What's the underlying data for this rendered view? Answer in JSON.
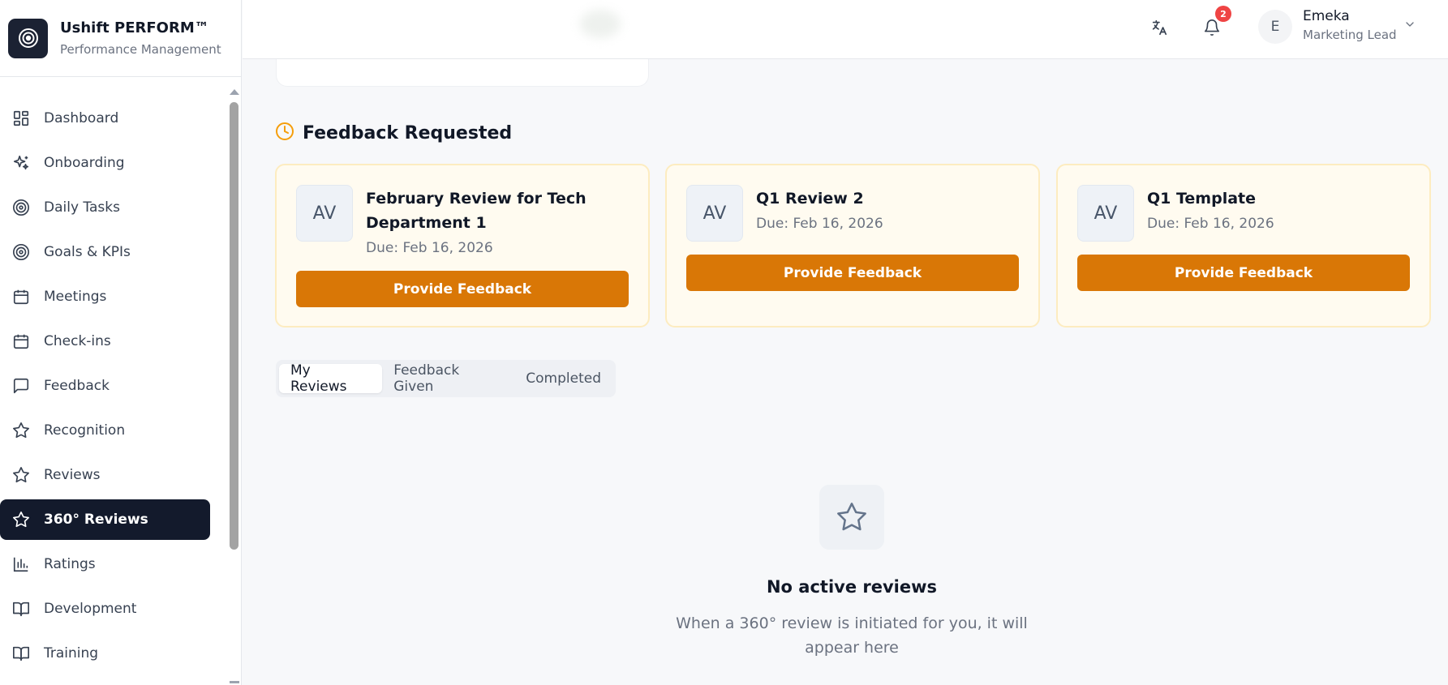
{
  "brand": {
    "title": "Ushift PERFORM™",
    "subtitle": "Performance Management"
  },
  "sidebar": {
    "items": [
      {
        "label": "Dashboard",
        "icon": "dashboard-icon"
      },
      {
        "label": "Onboarding",
        "icon": "sparkles-icon"
      },
      {
        "label": "Daily Tasks",
        "icon": "target-icon"
      },
      {
        "label": "Goals & KPIs",
        "icon": "target-icon"
      },
      {
        "label": "Meetings",
        "icon": "calendar-icon"
      },
      {
        "label": "Check-ins",
        "icon": "calendar-icon"
      },
      {
        "label": "Feedback",
        "icon": "message-icon"
      },
      {
        "label": "Recognition",
        "icon": "star-icon"
      },
      {
        "label": "Reviews",
        "icon": "star-icon"
      },
      {
        "label": "360° Reviews",
        "icon": "star-icon",
        "active": true
      },
      {
        "label": "Ratings",
        "icon": "bar-chart-icon"
      },
      {
        "label": "Development",
        "icon": "book-icon"
      },
      {
        "label": "Training",
        "icon": "book-icon"
      }
    ]
  },
  "topbar": {
    "notification_count": "2",
    "user": {
      "initial": "E",
      "name": "Emeka",
      "role": "Marketing Lead"
    }
  },
  "feedback_section": {
    "title": "Feedback Requested",
    "cards": [
      {
        "avatar": "AV",
        "title": "February Review for Tech Department 1",
        "due": "Due: Feb 16, 2026",
        "button": "Provide Feedback"
      },
      {
        "avatar": "AV",
        "title": "Q1 Review 2",
        "due": "Due: Feb 16, 2026",
        "button": "Provide Feedback"
      },
      {
        "avatar": "AV",
        "title": "Q1 Template",
        "due": "Due: Feb 16, 2026",
        "button": "Provide Feedback"
      }
    ]
  },
  "tabs": [
    {
      "label": "My Reviews",
      "active": true
    },
    {
      "label": "Feedback Given"
    },
    {
      "label": "Completed"
    }
  ],
  "empty_state": {
    "title": "No active reviews",
    "description": "When a 360° review is initiated for you, it will appear here"
  },
  "colors": {
    "accent": "#d97706",
    "active_nav": "#131a2c",
    "badge": "#ef4444"
  }
}
